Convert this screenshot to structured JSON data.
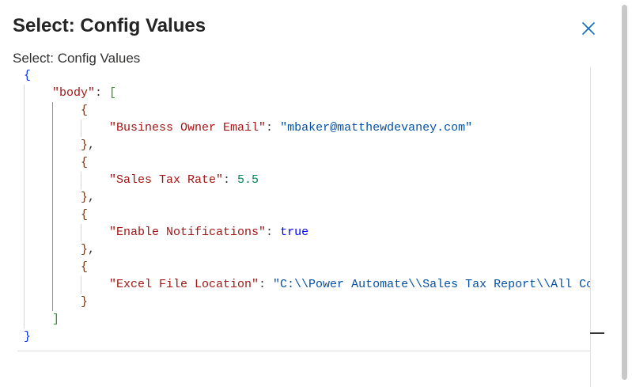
{
  "panel": {
    "title": "Select: Config Values",
    "close_icon": "close-icon"
  },
  "section": {
    "label": "Select: Config Values"
  },
  "json_view": {
    "lines": [
      {
        "indent": 0,
        "tokens": [
          {
            "t": "{",
            "c": "tok-bracket"
          }
        ]
      },
      {
        "indent": 1,
        "tokens": [
          {
            "t": "\"body\"",
            "c": "tok-key"
          },
          {
            "t": ": ",
            "c": "tok-punct"
          },
          {
            "t": "[",
            "c": "tok-bracket2"
          }
        ]
      },
      {
        "indent": 2,
        "tokens": [
          {
            "t": "{",
            "c": "tok-bracket3"
          }
        ]
      },
      {
        "indent": 3,
        "tokens": [
          {
            "t": "\"Business Owner Email\"",
            "c": "tok-key"
          },
          {
            "t": ": ",
            "c": "tok-punct"
          },
          {
            "t": "\"mbaker@matthewdevaney.com\"",
            "c": "tok-str"
          }
        ]
      },
      {
        "indent": 2,
        "tokens": [
          {
            "t": "}",
            "c": "tok-bracket3"
          },
          {
            "t": ",",
            "c": "tok-punct"
          }
        ]
      },
      {
        "indent": 2,
        "tokens": [
          {
            "t": "{",
            "c": "tok-bracket3"
          }
        ]
      },
      {
        "indent": 3,
        "tokens": [
          {
            "t": "\"Sales Tax Rate\"",
            "c": "tok-key"
          },
          {
            "t": ": ",
            "c": "tok-punct"
          },
          {
            "t": "5.5",
            "c": "tok-num"
          }
        ]
      },
      {
        "indent": 2,
        "tokens": [
          {
            "t": "}",
            "c": "tok-bracket3"
          },
          {
            "t": ",",
            "c": "tok-punct"
          }
        ]
      },
      {
        "indent": 2,
        "tokens": [
          {
            "t": "{",
            "c": "tok-bracket3"
          }
        ]
      },
      {
        "indent": 3,
        "tokens": [
          {
            "t": "\"Enable Notifications\"",
            "c": "tok-key"
          },
          {
            "t": ": ",
            "c": "tok-punct"
          },
          {
            "t": "true",
            "c": "tok-bool"
          }
        ]
      },
      {
        "indent": 2,
        "tokens": [
          {
            "t": "}",
            "c": "tok-bracket3"
          },
          {
            "t": ",",
            "c": "tok-punct"
          }
        ]
      },
      {
        "indent": 2,
        "tokens": [
          {
            "t": "{",
            "c": "tok-bracket3"
          }
        ]
      },
      {
        "indent": 3,
        "tokens": [
          {
            "t": "\"Excel File Location\"",
            "c": "tok-key"
          },
          {
            "t": ": ",
            "c": "tok-punct"
          },
          {
            "t": "\"C:\\\\Power Automate\\\\Sales Tax Report\\\\All Compa",
            "c": "tok-str"
          }
        ]
      },
      {
        "indent": 2,
        "tokens": [
          {
            "t": "}",
            "c": "tok-bracket3"
          }
        ]
      },
      {
        "indent": 1,
        "tokens": [
          {
            "t": "]",
            "c": "tok-bracket2"
          }
        ]
      },
      {
        "indent": 0,
        "tokens": [
          {
            "t": "}",
            "c": "tok-bracket"
          }
        ]
      }
    ]
  },
  "colors": {
    "key": "#a31515",
    "string": "#0451a5",
    "number": "#098658",
    "boolean": "#0000ff",
    "bracket_level1": "#0431fa",
    "bracket_level2": "#319331",
    "bracket_level3": "#7b3814",
    "close_icon": "#0f6cbd"
  }
}
